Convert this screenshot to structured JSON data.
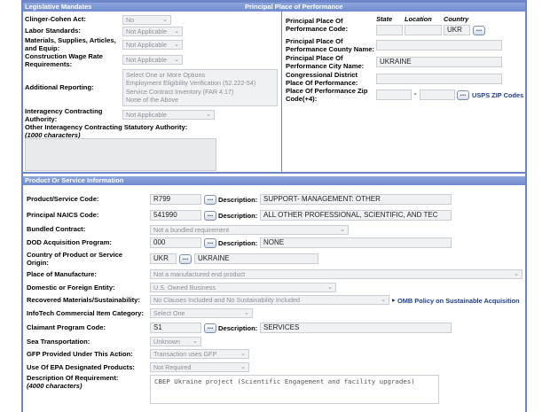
{
  "legislative": {
    "section_title": "Legislative Mandates",
    "clinger_cohen": {
      "label": "Clinger-Cohen Act:",
      "value": "No"
    },
    "labor_standards": {
      "label": "Labor Standards:",
      "value": "Not Applicable"
    },
    "materials": {
      "label_line1": "Materials, Supplies, Articles,",
      "label_line2": "and Equip:",
      "value": "Not Applicable"
    },
    "construction_wage": {
      "label_line1": "Construction Wage Rate",
      "label_line2": "Requirements:",
      "value": "Not Applicable"
    },
    "additional_reporting": {
      "label": "Additional Reporting:",
      "options": [
        "Select One or More Options",
        "Employment Eligibility Verification (52.222-54)",
        "Service Contract Inventory (FAR 4.17)",
        "None of the Above"
      ]
    },
    "interagency": {
      "label_line1": "Interagency Contracting",
      "label_line2": "Authority:",
      "value": "Not Applicable"
    },
    "other_interagency": {
      "label": "Other Interagency Contracting Statutory Authority:",
      "hint": "(1000 characters)"
    }
  },
  "place_of_performance": {
    "section_title": "Principal Place of Performance",
    "col_state": "State",
    "col_location": "Location",
    "col_country": "Country",
    "code": {
      "label_line1": "Principal Place Of",
      "label_line2": "Performance Code:",
      "country": "UKR"
    },
    "county": {
      "label_line1": "Principal Place Of",
      "label_line2": "Performance County Name:"
    },
    "city": {
      "label_line1": "Principal Place Of",
      "label_line2": "Performance City Name:",
      "value": "UKRAINE"
    },
    "congressional": {
      "label_line1": "Congressional District",
      "label_line2": "Place Of Performance:"
    },
    "zip": {
      "label_line1": "Place Of Performance Zip",
      "label_line2": "Code(+4):",
      "dash": "-",
      "link": "USPS ZIP Codes"
    }
  },
  "product": {
    "section_title": "Product Or Service Information",
    "description_label": "Description:",
    "psc": {
      "label": "Product/Service Code:",
      "code": "R799",
      "description": "SUPPORT- MANAGEMENT: OTHER"
    },
    "naics": {
      "label": "Principal NAICS Code:",
      "code": "541990",
      "description": "ALL OTHER PROFESSIONAL, SCIENTIFIC, AND TEC"
    },
    "bundled": {
      "label": "Bundled Contract:",
      "value": "Not a bundled requirement"
    },
    "dod_program": {
      "label": "DOD Acquisition Program:",
      "code": "000",
      "description": "NONE"
    },
    "origin": {
      "label_line1": "Country of Product or Service",
      "label_line2": "Origin:",
      "code": "UKR",
      "name": "UKRAINE"
    },
    "manufacture": {
      "label": "Place of Manufacture:",
      "value": "Not a manufactured end product"
    },
    "entity": {
      "label": "Domestic or Foreign Entity:",
      "value": "U.S. Owned Business"
    },
    "recovered": {
      "label": "Recovered Materials/Sustainability:",
      "value": "No Clauses Included and No Sustainability Included",
      "link": "OMB Policy on Sustainable Acquisition"
    },
    "infotech": {
      "label": "InfoTech Commercial Item Category:",
      "value": "Select One"
    },
    "claimant": {
      "label": "Claimant Program Code:",
      "code": "S1",
      "description": "SERVICES"
    },
    "sea": {
      "label": "Sea Transportation:",
      "value": "Unknown"
    },
    "gfp": {
      "label": "GFP Provided Under This Action:",
      "value": "Transaction uses GFP"
    },
    "epa": {
      "label": "Use Of EPA Designated Products:",
      "value": "Not Required"
    },
    "requirement": {
      "label": "Description Of Requirement:",
      "hint": "(4000 characters)",
      "value": "CBEP Ukraine project (Scientific Engagement and facility upgrades)"
    }
  },
  "icons": {
    "lookup": "ellipsis-lookup-icon",
    "dropdown": "chevron-down-icon"
  }
}
